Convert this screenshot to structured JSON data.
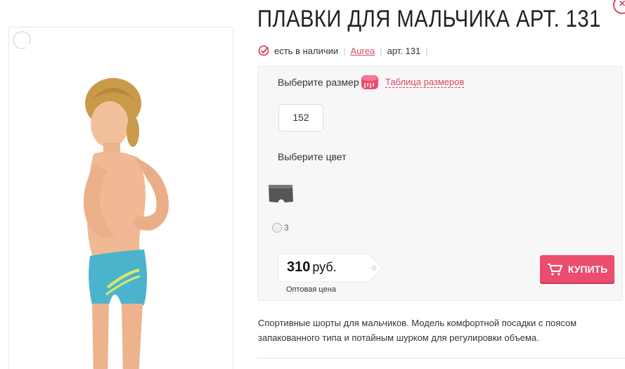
{
  "product": {
    "title": "ПЛАВКИ ДЛЯ МАЛЬЧИКА АРТ. 131",
    "availability": "есть в наличии",
    "brand": "Aurea",
    "article": "арт. 131",
    "description": "Спортивные шорты для мальчиков. Модель комфортной посадки с поясом запакованного типа и потайным шурком для регулировки объема."
  },
  "options": {
    "size_label": "Выберите размер",
    "size_chart_link": "Таблица размеров",
    "selected_size": "152",
    "color_label": "Выберите цвет",
    "color_option_label": "3"
  },
  "price": {
    "value": "310",
    "unit": "руб.",
    "note": "Оптовая цена"
  },
  "buy_button": {
    "label": "КУПИТЬ"
  },
  "icons": {
    "availability": "check-circle-icon",
    "size_chart": "measuring-tape-icon",
    "zoom": "magnifier-icon",
    "cart": "cart-icon",
    "close": "close-icon"
  },
  "colors": {
    "accent": "#ec4c6e",
    "link": "#d94866",
    "swim_trunks": "#4bb4cc"
  }
}
